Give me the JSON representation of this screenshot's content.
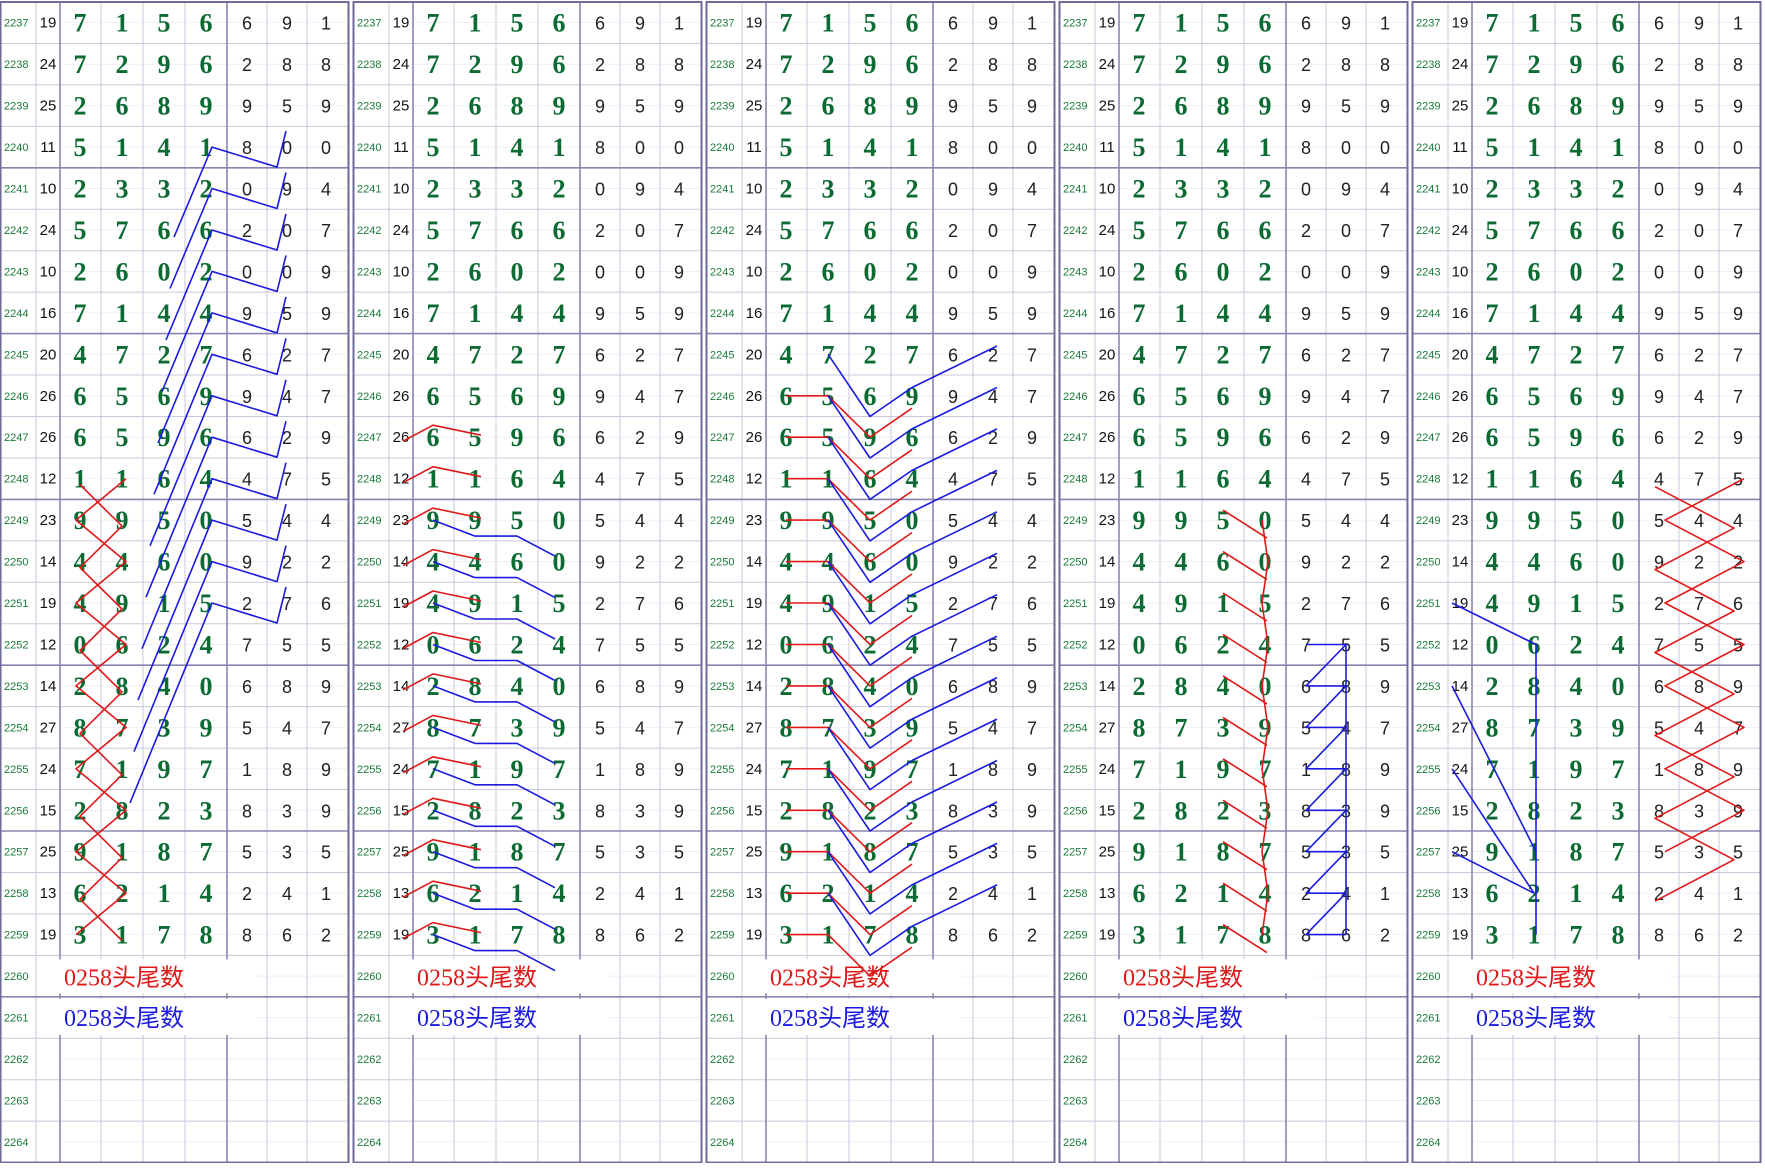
{
  "rows": [
    {
      "period": "2237",
      "sum": "19",
      "main": [
        "7",
        "1",
        "5",
        "6"
      ],
      "extra": [
        "6",
        "9",
        "1"
      ]
    },
    {
      "period": "2238",
      "sum": "24",
      "main": [
        "7",
        "2",
        "9",
        "6"
      ],
      "extra": [
        "2",
        "8",
        "8"
      ]
    },
    {
      "period": "2239",
      "sum": "25",
      "main": [
        "2",
        "6",
        "8",
        "9"
      ],
      "extra": [
        "9",
        "5",
        "9"
      ]
    },
    {
      "period": "2240",
      "sum": "11",
      "main": [
        "5",
        "1",
        "4",
        "1"
      ],
      "extra": [
        "8",
        "0",
        "0"
      ]
    },
    {
      "period": "2241",
      "sum": "10",
      "main": [
        "2",
        "3",
        "3",
        "2"
      ],
      "extra": [
        "0",
        "9",
        "4"
      ]
    },
    {
      "period": "2242",
      "sum": "24",
      "main": [
        "5",
        "7",
        "6",
        "6"
      ],
      "extra": [
        "2",
        "0",
        "7"
      ]
    },
    {
      "period": "2243",
      "sum": "10",
      "main": [
        "2",
        "6",
        "0",
        "2"
      ],
      "extra": [
        "0",
        "0",
        "9"
      ]
    },
    {
      "period": "2244",
      "sum": "16",
      "main": [
        "7",
        "1",
        "4",
        "4"
      ],
      "extra": [
        "9",
        "5",
        "9"
      ]
    },
    {
      "period": "2245",
      "sum": "20",
      "main": [
        "4",
        "7",
        "2",
        "7"
      ],
      "extra": [
        "6",
        "2",
        "7"
      ]
    },
    {
      "period": "2246",
      "sum": "26",
      "main": [
        "6",
        "5",
        "6",
        "9"
      ],
      "extra": [
        "9",
        "4",
        "7"
      ]
    },
    {
      "period": "2247",
      "sum": "26",
      "main": [
        "6",
        "5",
        "9",
        "6"
      ],
      "extra": [
        "6",
        "2",
        "9"
      ]
    },
    {
      "period": "2248",
      "sum": "12",
      "main": [
        "1",
        "1",
        "6",
        "4"
      ],
      "extra": [
        "4",
        "7",
        "5"
      ]
    },
    {
      "period": "2249",
      "sum": "23",
      "main": [
        "9",
        "9",
        "5",
        "0"
      ],
      "extra": [
        "5",
        "4",
        "4"
      ]
    },
    {
      "period": "2250",
      "sum": "14",
      "main": [
        "4",
        "4",
        "6",
        "0"
      ],
      "extra": [
        "9",
        "2",
        "2"
      ]
    },
    {
      "period": "2251",
      "sum": "19",
      "main": [
        "4",
        "9",
        "1",
        "5"
      ],
      "extra": [
        "2",
        "7",
        "6"
      ]
    },
    {
      "period": "2252",
      "sum": "12",
      "main": [
        "0",
        "6",
        "2",
        "4"
      ],
      "extra": [
        "7",
        "5",
        "5"
      ]
    },
    {
      "period": "2253",
      "sum": "14",
      "main": [
        "2",
        "8",
        "4",
        "0"
      ],
      "extra": [
        "6",
        "8",
        "9"
      ]
    },
    {
      "period": "2254",
      "sum": "27",
      "main": [
        "8",
        "7",
        "3",
        "9"
      ],
      "extra": [
        "5",
        "4",
        "7"
      ]
    },
    {
      "period": "2255",
      "sum": "24",
      "main": [
        "7",
        "1",
        "9",
        "7"
      ],
      "extra": [
        "1",
        "8",
        "9"
      ]
    },
    {
      "period": "2256",
      "sum": "15",
      "main": [
        "2",
        "8",
        "2",
        "3"
      ],
      "extra": [
        "8",
        "3",
        "9"
      ]
    },
    {
      "period": "2257",
      "sum": "25",
      "main": [
        "9",
        "1",
        "8",
        "7"
      ],
      "extra": [
        "5",
        "3",
        "5"
      ]
    },
    {
      "period": "2258",
      "sum": "13",
      "main": [
        "6",
        "2",
        "1",
        "4"
      ],
      "extra": [
        "2",
        "4",
        "1"
      ]
    },
    {
      "period": "2259",
      "sum": "19",
      "main": [
        "3",
        "1",
        "7",
        "8"
      ],
      "extra": [
        "8",
        "6",
        "2"
      ]
    },
    {
      "period": "2260",
      "sum": "",
      "main": [
        "",
        "",
        "",
        ""
      ],
      "extra": [
        "",
        "",
        ""
      ]
    },
    {
      "period": "2261",
      "sum": "",
      "main": [
        "",
        "",
        "",
        ""
      ],
      "extra": [
        "",
        "",
        ""
      ]
    },
    {
      "period": "2262",
      "sum": "",
      "main": [
        "",
        "",
        "",
        ""
      ],
      "extra": [
        "",
        "",
        ""
      ]
    },
    {
      "period": "2263",
      "sum": "",
      "main": [
        "",
        "",
        "",
        ""
      ],
      "extra": [
        "",
        "",
        ""
      ]
    },
    {
      "period": "2264",
      "sum": "",
      "main": [
        "",
        "",
        "",
        ""
      ],
      "extra": [
        "",
        "",
        ""
      ]
    }
  ],
  "panels": [
    {
      "label_red": "0258头尾数",
      "label_blue": "0258头尾数"
    },
    {
      "label_red": "0258头尾数",
      "label_blue": "0258头尾数"
    },
    {
      "label_red": "0258头尾数",
      "label_blue": "0258头尾数"
    },
    {
      "label_red": "0258头尾数",
      "label_blue": "0258头尾数"
    },
    {
      "label_red": "0258头尾数",
      "label_blue": "0258头尾数"
    }
  ],
  "colors": {
    "grid_fine": "#c8c8dc",
    "grid_major": "#8a85b0",
    "panel_border": "#6e6a9a",
    "period_text": "#1a7a3a",
    "sum_text": "#111111",
    "main_digit": "#0b6b32",
    "extra_digit": "#222222",
    "line_red": "#e01818",
    "line_blue": "#1a1ae0"
  }
}
